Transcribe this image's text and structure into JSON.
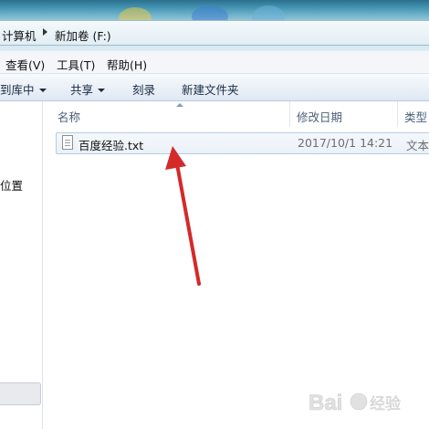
{
  "address_bar": {
    "crumbs": [
      "计算机",
      "新加卷 (F:)"
    ]
  },
  "menubar": {
    "items": [
      "查看(V)",
      "工具(T)",
      "帮助(H)"
    ]
  },
  "toolbar": {
    "include_library": "到库中",
    "share": "共享",
    "burn": "刻录",
    "new_folder": "新建文件夹"
  },
  "nav_pane": {
    "item_label": "位置"
  },
  "file_list": {
    "columns": {
      "name": "名称",
      "modified": "修改日期",
      "type": "类型"
    },
    "files": [
      {
        "name": "百度经验.txt",
        "modified": "2017/10/1 14:21",
        "type": "文本"
      }
    ]
  },
  "colors": {
    "annotation_arrow": "#d42a2a",
    "selection_border": "#b6ccde"
  },
  "watermark": {
    "text": "Baidu 经验"
  }
}
